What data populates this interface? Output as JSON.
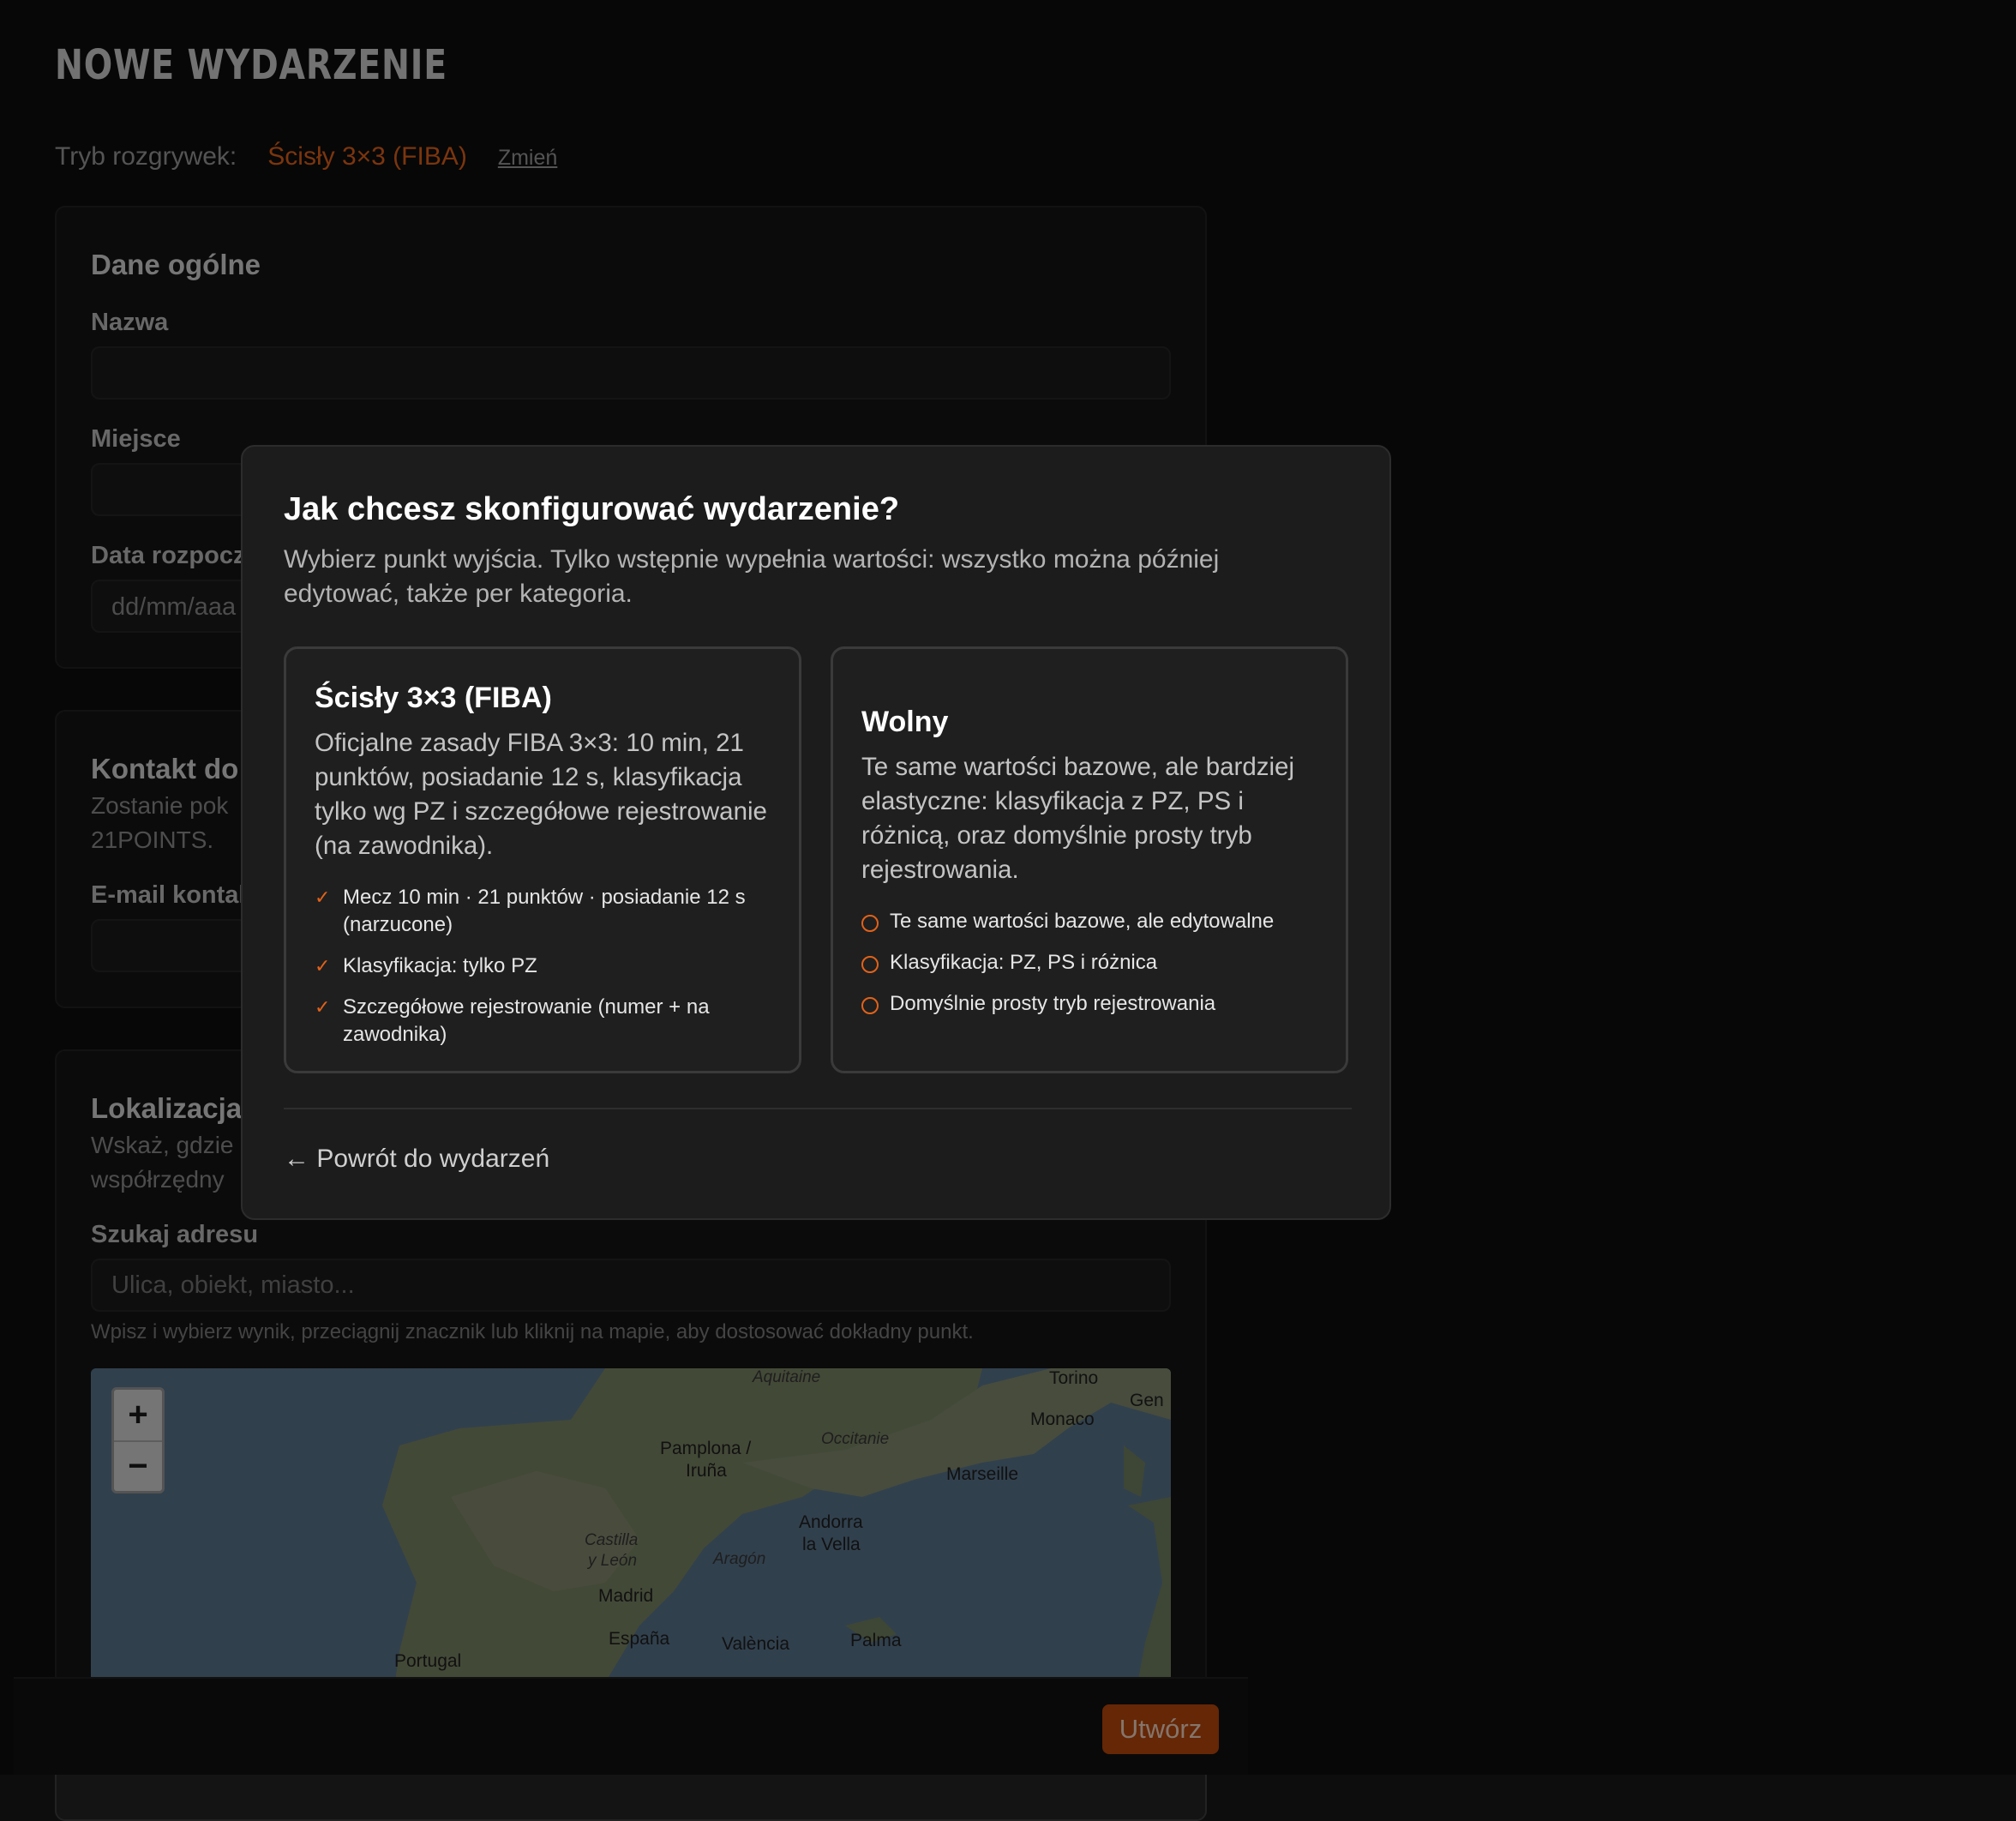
{
  "header": {
    "title": "NOWE WYDARZENIE",
    "mode_label": "Tryb rozgrywek:",
    "mode_value": "Ścisły 3×3 (FIBA)",
    "mode_change": "Zmień"
  },
  "general": {
    "title": "Dane ogólne",
    "name_label": "Nazwa",
    "place_label": "Miejsce",
    "date_label": "Data rozpocz",
    "date_placeholder": "dd/mm/aaa"
  },
  "contact": {
    "title": "Kontakt do",
    "description": "Zostanie pok\n21POINTS.",
    "email_label": "E-mail kontak"
  },
  "location": {
    "title": "Lokalizacja",
    "description": "Wskaż, gdzie\nwspółrzędny",
    "search_label": "Szukaj adresu",
    "search_placeholder": "Ulica, obiekt, miasto...",
    "hint": "Wpisz i wybierz wynik, przeciągnij znacznik lub kliknij na mapie, aby dostosować dokładny punkt.",
    "zoom_in": "+",
    "zoom_out": "−",
    "map_labels": [
      "Aquitaine",
      "Torino",
      "Gen",
      "Monaco",
      "Pamplona /",
      "Iruña",
      "Occitanie",
      "Marseille",
      "Andorra",
      "la Vella",
      "Castilla",
      "y León",
      "Aragón",
      "Madrid",
      "España",
      "València",
      "Palma",
      "Portugal"
    ]
  },
  "footer": {
    "create_label": "Utwórz"
  },
  "modal": {
    "title": "Jak chcesz skonfigurować wydarzenie?",
    "description": "Wybierz punkt wyjścia. Tylko wstępnie wypełnia wartości: wszystko można później edytować, także per kategoria.",
    "options": [
      {
        "title": "Ścisły 3×3 (FIBA)",
        "description": "Oficjalne zasady FIBA 3×3: 10 min, 21 punktów, posiadanie 12 s, klasyfikacja tylko wg PZ i szczegółowe rejestrowanie (na zawodnika).",
        "items": [
          "Mecz 10 min · 21 punktów · posiadanie 12 s (narzucone)",
          "Klasyfikacja: tylko PZ",
          "Szczegółowe rejestrowanie (numer + na zawodnika)"
        ]
      },
      {
        "title": "Wolny",
        "description": "Te same wartości bazowe, ale bardziej elastyczne: klasyfikacja z PZ, PS i różnicą, oraz domyślnie prosty tryb rejestrowania.",
        "items": [
          "Te same wartości bazowe, ale edytowalne",
          "Klasyfikacja: PZ, PS i różnica",
          "Domyślnie prosty tryb rejestrowania"
        ]
      }
    ],
    "check_mark": "✓",
    "back_label": "← Powrót do wydarzeń"
  },
  "colors": {
    "accent": "#e0621a",
    "button": "#b8470c",
    "background": "#0d0d0d",
    "modal": "#1c1c1c"
  }
}
